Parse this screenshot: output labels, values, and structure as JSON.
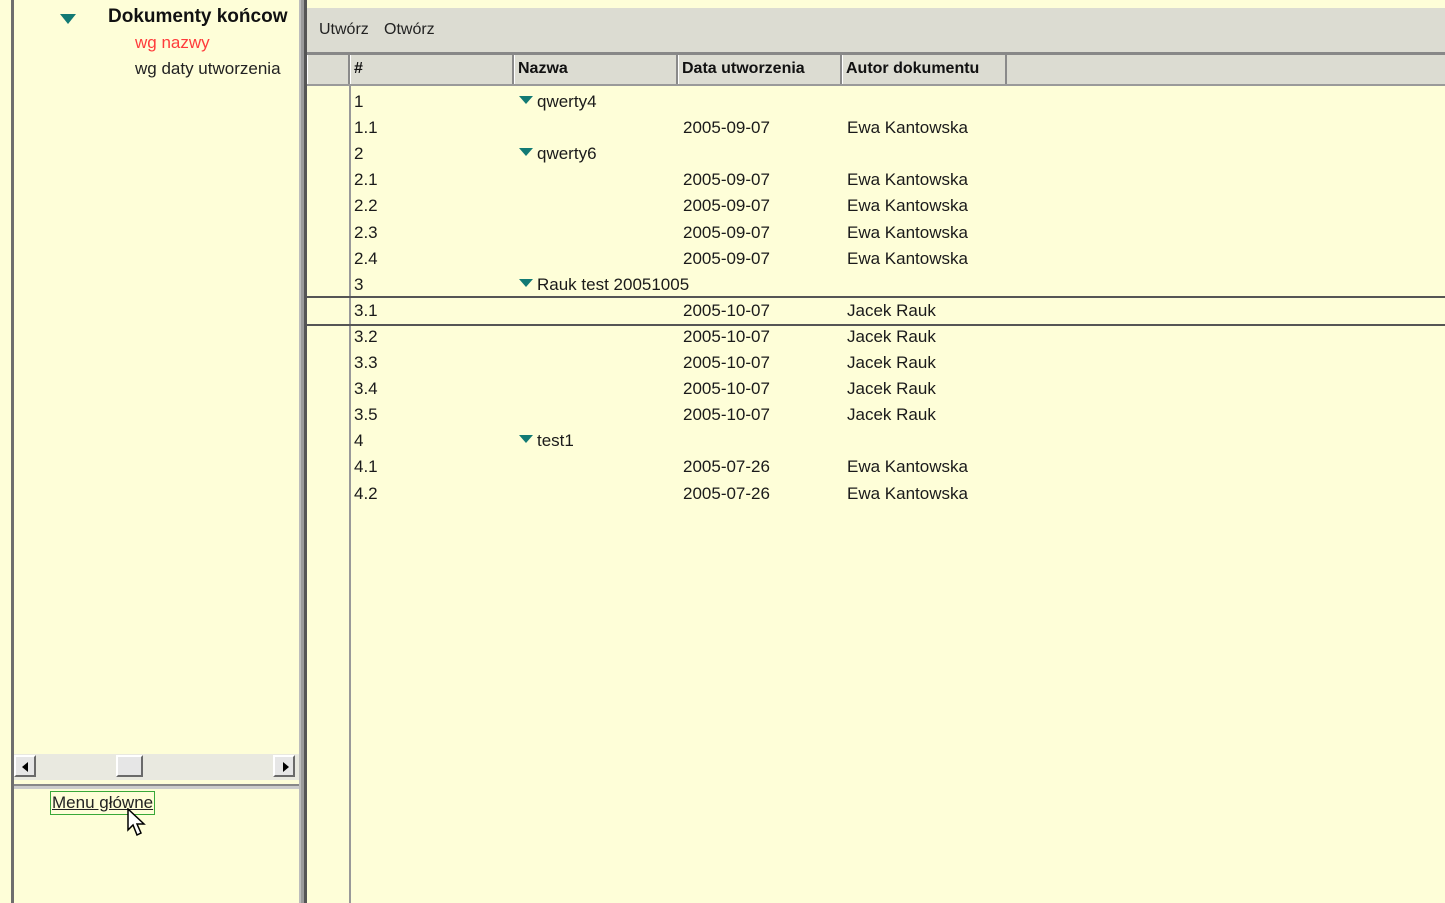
{
  "left_panel": {
    "tree": {
      "root_label": "Dokumenty końcow",
      "children": [
        {
          "label": "wg nazwy",
          "active": true
        },
        {
          "label": "wg daty utworzenia",
          "active": false
        }
      ]
    },
    "menu_link": "Menu główne"
  },
  "toolbar": {
    "buttons": [
      "Utwórz",
      "Otwórz"
    ]
  },
  "table": {
    "columns": [
      "#",
      "Nazwa",
      "Data utworzenia",
      "Autor dokumentu"
    ],
    "rows": [
      {
        "num": "1",
        "name": "qwerty4",
        "group": true,
        "date": "",
        "author": ""
      },
      {
        "num": "1.1",
        "name": "",
        "group": false,
        "date": "2005-09-07",
        "author": "Ewa Kantowska"
      },
      {
        "num": "2",
        "name": "qwerty6",
        "group": true,
        "date": "",
        "author": ""
      },
      {
        "num": "2.1",
        "name": "",
        "group": false,
        "date": "2005-09-07",
        "author": "Ewa Kantowska"
      },
      {
        "num": "2.2",
        "name": "",
        "group": false,
        "date": "2005-09-07",
        "author": "Ewa Kantowska"
      },
      {
        "num": "2.3",
        "name": "",
        "group": false,
        "date": "2005-09-07",
        "author": "Ewa Kantowska"
      },
      {
        "num": "2.4",
        "name": "",
        "group": false,
        "date": "2005-09-07",
        "author": "Ewa Kantowska"
      },
      {
        "num": "3",
        "name": "Rauk test 20051005",
        "group": true,
        "date": "",
        "author": ""
      },
      {
        "num": "3.1",
        "name": "",
        "group": false,
        "date": "2005-10-07",
        "author": "Jacek Rauk",
        "selected": true
      },
      {
        "num": "3.2",
        "name": "",
        "group": false,
        "date": "2005-10-07",
        "author": "Jacek Rauk"
      },
      {
        "num": "3.3",
        "name": "",
        "group": false,
        "date": "2005-10-07",
        "author": "Jacek Rauk"
      },
      {
        "num": "3.4",
        "name": "",
        "group": false,
        "date": "2005-10-07",
        "author": "Jacek Rauk"
      },
      {
        "num": "3.5",
        "name": "",
        "group": false,
        "date": "2005-10-07",
        "author": "Jacek Rauk"
      },
      {
        "num": "4",
        "name": "test1",
        "group": true,
        "date": "",
        "author": ""
      },
      {
        "num": "4.1",
        "name": "",
        "group": false,
        "date": "2005-07-26",
        "author": "Ewa Kantowska"
      },
      {
        "num": "4.2",
        "name": "",
        "group": false,
        "date": "2005-07-26",
        "author": "Ewa Kantowska"
      }
    ]
  },
  "colors": {
    "background": "#fefed8",
    "active_link": "#ff3b3b",
    "tree_arrow": "#127a74",
    "toolbar": "#dcdcd2"
  }
}
